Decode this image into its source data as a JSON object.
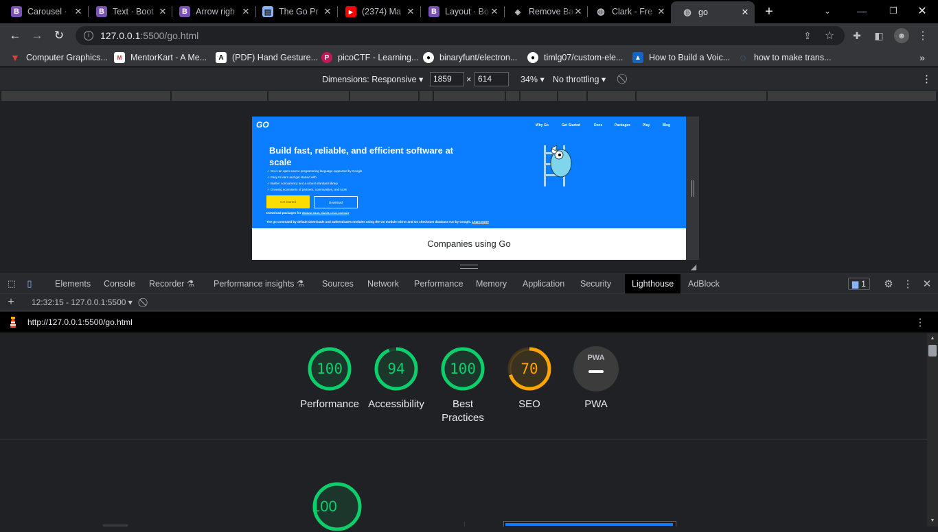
{
  "tabs": [
    {
      "title": "Carousel ·",
      "fav": "B",
      "fav_color": "#7952b3"
    },
    {
      "title": "Text · Boot",
      "fav": "B",
      "fav_color": "#7952b3"
    },
    {
      "title": "Arrow righ",
      "fav": "B",
      "fav_color": "#7952b3"
    },
    {
      "title": "The Go Pr",
      "fav": "doc",
      "fav_color": "#8ab4f8"
    },
    {
      "title": "(2374) Ma",
      "fav": "yt",
      "fav_color": "#ff0000"
    },
    {
      "title": "Layout · Bo",
      "fav": "B",
      "fav_color": "#7952b3"
    },
    {
      "title": "Remove Ba",
      "fav": "layers",
      "fav_color": "#bdc1c6"
    },
    {
      "title": "Clark - Fre",
      "fav": "globe",
      "fav_color": "#bdc1c6"
    },
    {
      "title": "go",
      "fav": "globe",
      "fav_color": "#bdc1c6",
      "active": true
    }
  ],
  "omnibox": {
    "url_host": "127.0.0.1",
    "url_rest": ":5500/go.html"
  },
  "bookmarks": [
    {
      "label": "Computer Graphics...",
      "icon": "red-v-icon"
    },
    {
      "label": "MentorKart - A Me...",
      "icon": "mentorkart-icon"
    },
    {
      "label": "(PDF) Hand Gesture...",
      "icon": "academia-icon"
    },
    {
      "label": "picoCTF - Learning...",
      "icon": "picoctf-icon"
    },
    {
      "label": "binaryfunt/electron...",
      "icon": "github-icon"
    },
    {
      "label": "timlg07/custom-ele...",
      "icon": "github-icon"
    },
    {
      "label": "How to Build a Voic...",
      "icon": "site-icon"
    },
    {
      "label": "how to make trans...",
      "icon": "blue-circle-icon"
    }
  ],
  "device_toolbar": {
    "dimensions": "Dimensions: Responsive",
    "width": "1859",
    "height": "614",
    "times": "×",
    "zoom": "34%",
    "throttling": "No throttling"
  },
  "go_page": {
    "logo": "GO",
    "nav": [
      "Why Go",
      "Get Started",
      "Docs",
      "Packages",
      "Play",
      "Blog"
    ],
    "headline": "Build fast, reliable, and efficient software at scale",
    "bullets": [
      "Go is an open source programming language supported by Google",
      "Easy to learn and get started with",
      "Built-in concurrency and a robust standard library",
      "Growing ecosystem of partners, communities, and tools"
    ],
    "get_started": "Get Started",
    "download": "Download",
    "packages_prefix": "Download packages for",
    "packages_links": "Windows 64-bit, macOS, Linux, and more",
    "command_note": "The go command by default downloads and authenticates modules using the Go module mirror and Go checksum database run by Google.",
    "learn_more": "Learn more",
    "companies_heading": "Companies using Go"
  },
  "devtools_tabs": [
    "Elements",
    "Console",
    "Recorder",
    "Performance insights",
    "Sources",
    "Network",
    "Performance",
    "Memory",
    "Application",
    "Security",
    "Lighthouse",
    "AdBlock"
  ],
  "issues_count": "1",
  "lighthouse": {
    "report_selector": "12:32:15 - 127.0.0.1:5500",
    "page_url": "http://127.0.0.1:5500/go.html",
    "scores": [
      {
        "label": "Performance",
        "score": "100",
        "fraction": 1.0,
        "color": "#0cce6b"
      },
      {
        "label": "Accessibility",
        "score": "94",
        "fraction": 0.94,
        "color": "#0cce6b"
      },
      {
        "label": "Best Practices",
        "score": "100",
        "fraction": 1.0,
        "color": "#0cce6b"
      },
      {
        "label": "SEO",
        "score": "70",
        "fraction": 0.7,
        "color": "#ffa400"
      },
      {
        "label": "PWA",
        "score": "PWA",
        "fraction": 0,
        "color": "#9aa0a6"
      }
    ],
    "big_score": {
      "score": "100",
      "fraction": 1.0,
      "color": "#0cce6b"
    }
  },
  "colors": {
    "pass": "#0cce6b",
    "average": "#ffa400",
    "go_blue": "#0b7dff",
    "go_yellow": "#fddd00"
  }
}
